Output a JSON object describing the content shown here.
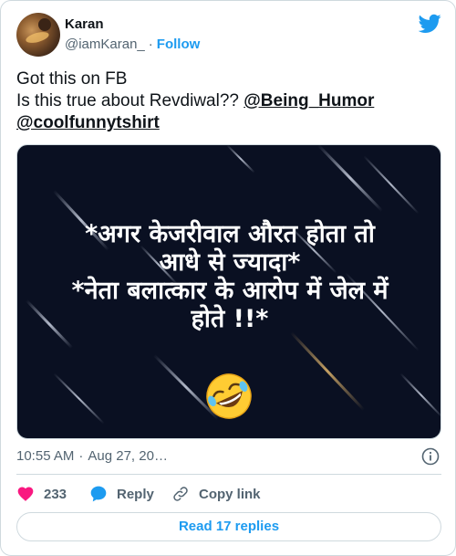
{
  "author": {
    "display_name": "Karan",
    "handle": "@iamKaran_",
    "separator": "·",
    "follow_label": "Follow"
  },
  "tweet": {
    "line1": "Got this on FB",
    "line2_prefix": "Is this true about Revdiwal?? ",
    "mention1": "@Being_Humor",
    "mention2": "@coolfunnytshirt"
  },
  "media": {
    "line1": "*अगर केजरीवाल औरत होता तो",
    "line2": "आधे से ज्यादा*",
    "line3": "*नेता बलात्कार के आरोप में जेल में",
    "line4": "होते !!*",
    "emoji_name": "rolling-on-the-floor-laughing-emoji"
  },
  "meta": {
    "time": "10:55 AM",
    "separator": "·",
    "date": "Aug 27, 20…"
  },
  "actions": {
    "like_count": "233",
    "reply_label": "Reply",
    "copy_link_label": "Copy link"
  },
  "read_replies_label": "Read 17 replies",
  "colors": {
    "accent": "#1d9bf0",
    "like": "#f91880",
    "text": "#0f1419",
    "secondary": "#536471",
    "border": "#cfd9de",
    "media_bg": "#0a1022"
  }
}
